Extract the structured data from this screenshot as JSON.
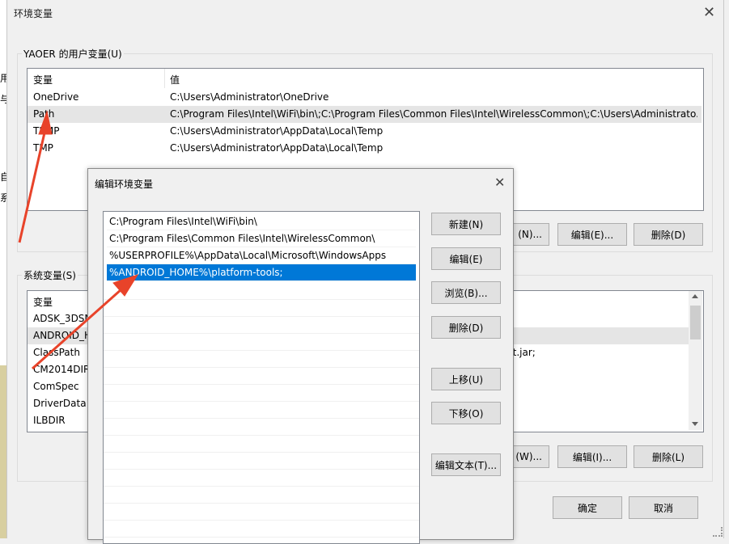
{
  "window": {
    "title": "环境变量",
    "close": "✕"
  },
  "user_vars": {
    "label": "YAOER 的用户变量(U)",
    "columns": [
      "变量",
      "值"
    ],
    "rows": [
      {
        "name": "OneDrive",
        "value": "C:\\Users\\Administrator\\OneDrive"
      },
      {
        "name": "Path",
        "value": "C:\\Program Files\\Intel\\WiFi\\bin\\;C:\\Program Files\\Common Files\\Intel\\WirelessCommon\\;C:\\Users\\Administrato..."
      },
      {
        "name": "TEMP",
        "value": "C:\\Users\\Administrator\\AppData\\Local\\Temp"
      },
      {
        "name": "TMP",
        "value": "C:\\Users\\Administrator\\AppData\\Local\\Temp"
      }
    ],
    "buttons": {
      "new": "(N)...",
      "edit": "编辑(E)...",
      "delete": "删除(D)"
    }
  },
  "system_vars": {
    "label": "系统变量(S)",
    "columns": [
      "变量"
    ],
    "rows": [
      "ADSK_3DSM",
      "ANDROID_H",
      "ClassPath",
      "CM2014DIR",
      "ComSpec",
      "DriverData",
      "ILBDIR"
    ],
    "value_fragment": "dt.jar;",
    "buttons": {
      "new": "(W)...",
      "edit": "编辑(I)...",
      "delete": "删除(L)"
    }
  },
  "side_fragments": [
    "用",
    "与",
    "自",
    "系"
  ],
  "main_buttons": {
    "ok": "确定",
    "cancel": "取消"
  },
  "edit_dialog": {
    "title": "编辑环境变量",
    "close": "✕",
    "items": [
      "C:\\Program Files\\Intel\\WiFi\\bin\\",
      "C:\\Program Files\\Common Files\\Intel\\WirelessCommon\\",
      "%USERPROFILE%\\AppData\\Local\\Microsoft\\WindowsApps",
      "%ANDROID_HOME%\\platform-tools;"
    ],
    "selected_index": 3,
    "buttons": {
      "new": "新建(N)",
      "edit": "编辑(E)",
      "browse": "浏览(B)...",
      "delete": "删除(D)",
      "move_up": "上移(U)",
      "move_down": "下移(O)",
      "edit_text": "编辑文本(T)..."
    }
  },
  "colors": {
    "selection": "#0078d7",
    "annotation_arrow": "#e8432a"
  }
}
